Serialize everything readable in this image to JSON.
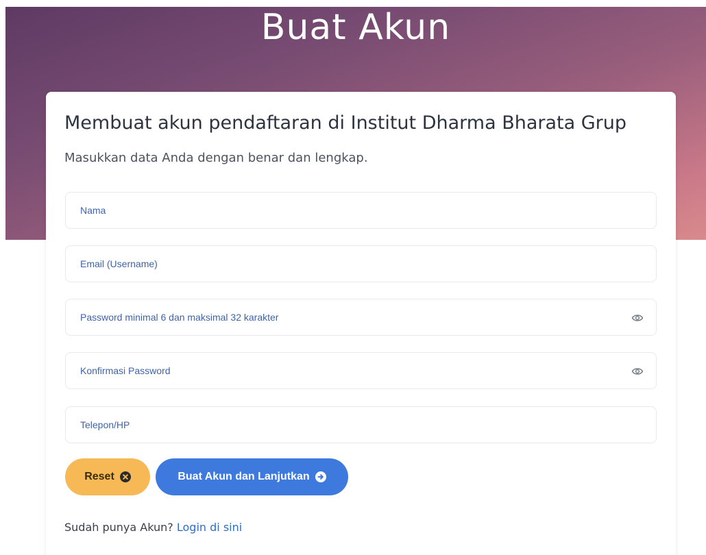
{
  "hero": {
    "title": "Buat Akun"
  },
  "card": {
    "heading": "Membuat akun pendaftaran di Institut Dharma Bharata Grup",
    "subtitle": "Masukkan data Anda dengan benar dan lengkap."
  },
  "form": {
    "fields": [
      {
        "name": "name",
        "placeholder": "Nama",
        "value": ""
      },
      {
        "name": "email",
        "placeholder": "Email (Username)",
        "value": ""
      },
      {
        "name": "password",
        "placeholder": "Password minimal 6 dan maksimal 32 karakter",
        "value": ""
      },
      {
        "name": "confirm_password",
        "placeholder": "Konfirmasi Password",
        "value": ""
      },
      {
        "name": "phone",
        "placeholder": "Telepon/HP",
        "value": ""
      }
    ],
    "reset_label": "Reset",
    "submit_label": "Buat Akun dan Lanjutkan"
  },
  "footer": {
    "prompt": "Sudah punya Akun?",
    "login_link": "Login di sini"
  },
  "icons": {
    "reset": "x-circle-icon",
    "submit": "arrow-right-circle-icon",
    "password_toggle": "eye-icon"
  },
  "colors": {
    "hero_gradient_start": "#5e3a63",
    "hero_gradient_end": "#d98a8c",
    "reset_button": "#f7b955",
    "submit_button": "#3e7ade",
    "link": "#2f6fc6",
    "placeholder": "#3f63a8"
  }
}
